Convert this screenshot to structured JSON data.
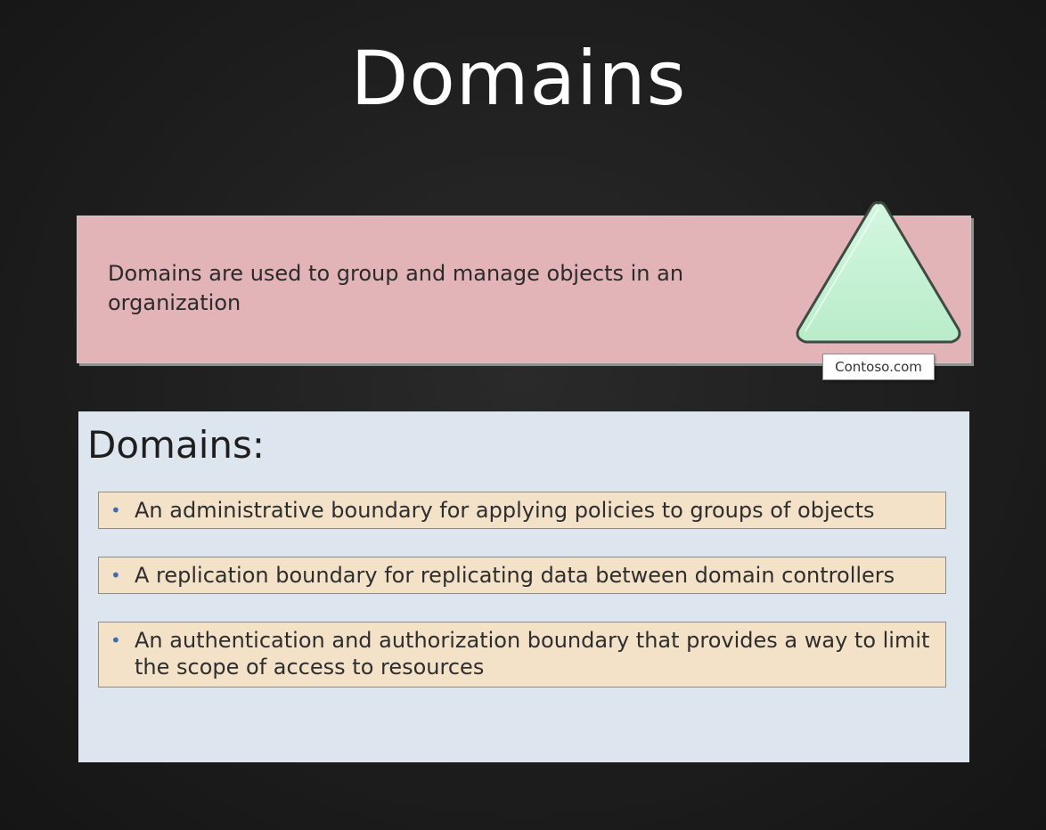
{
  "slide": {
    "title": "Domains"
  },
  "definition": {
    "text": "Domains are used to group and manage objects in an organization",
    "domain_label": "Contoso.com"
  },
  "info_panel": {
    "heading": "Domains:",
    "bullets": [
      "An administrative boundary for applying policies to groups of objects",
      "A replication boundary for replicating data between domain controllers",
      "An authentication and authorization boundary that provides a way to limit the scope of access to resources"
    ]
  },
  "colors": {
    "background": "#1e1e1e",
    "definition_box": "#e2b4b7",
    "triangle_fill": "#c4f2d3",
    "info_panel": "#dde5ef",
    "bullet_box": "#f3e2c8",
    "bullet_dot": "#3b6fb0"
  },
  "icons": {
    "domain_shape": "triangle-domain-icon",
    "bullet": "bullet-dot-icon"
  }
}
